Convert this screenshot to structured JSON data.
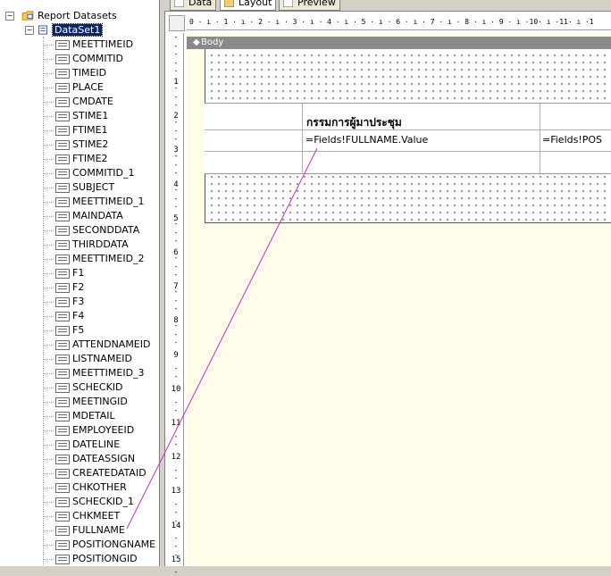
{
  "tabs": [
    {
      "label": "Data"
    },
    {
      "label": "Layout"
    },
    {
      "label": "Preview"
    }
  ],
  "tree": {
    "root_label": "Report Datasets",
    "dataset_label": "DataSet1",
    "fields": [
      "MEETTIMEID",
      "COMMITID",
      "TIMEID",
      "PLACE",
      "CMDATE",
      "STIME1",
      "FTIME1",
      "STIME2",
      "FTIME2",
      "COMMITID_1",
      "SUBJECT",
      "MEETTIMEID_1",
      "MAINDATA",
      "SECONDDATA",
      "THIRDDATA",
      "MEETTIMEID_2",
      "F1",
      "F2",
      "F3",
      "F4",
      "F5",
      "ATTENDNAMEID",
      "LISTNAMEID",
      "MEETTIMEID_3",
      "SCHECKID",
      "MEETINGID",
      "MDETAIL",
      "EMPLOYEEID",
      "DATELINE",
      "DATEASSIGN",
      "CREATEDATAID",
      "CHKOTHER",
      "SCHECKID_1",
      "CHKMEET",
      "FULLNAME",
      "POSITIONGNAME",
      "POSITIONGID"
    ],
    "icons": {
      "root": "report-datasets-icon",
      "dataset": "dataset-icon",
      "field": "field-icon"
    }
  },
  "ruler": {
    "horizontal": "0 · ı · 1 · ı · 2 · ı · 3 · ı · 4 · ı · 5 · ı · 6 · ı · 7 · ı · 8 · ı · 9 · ı ·10· ı ·11· ı ·1",
    "vertical_numbers": [
      "1",
      "2",
      "3",
      "4",
      "5",
      "6",
      "7",
      "8",
      "9",
      "10",
      "11",
      "12",
      "13",
      "14",
      "15"
    ]
  },
  "designer": {
    "body_label": "Body",
    "table": {
      "header_cell": "กรรมการผู้มาประชุม",
      "detail_cells": [
        "=Fields!FULLNAME.Value",
        "=Fields!POS"
      ]
    }
  },
  "colors": {
    "selection": "#0a246a",
    "drag_line": "#c030c0",
    "canvas": "#fffcea"
  }
}
